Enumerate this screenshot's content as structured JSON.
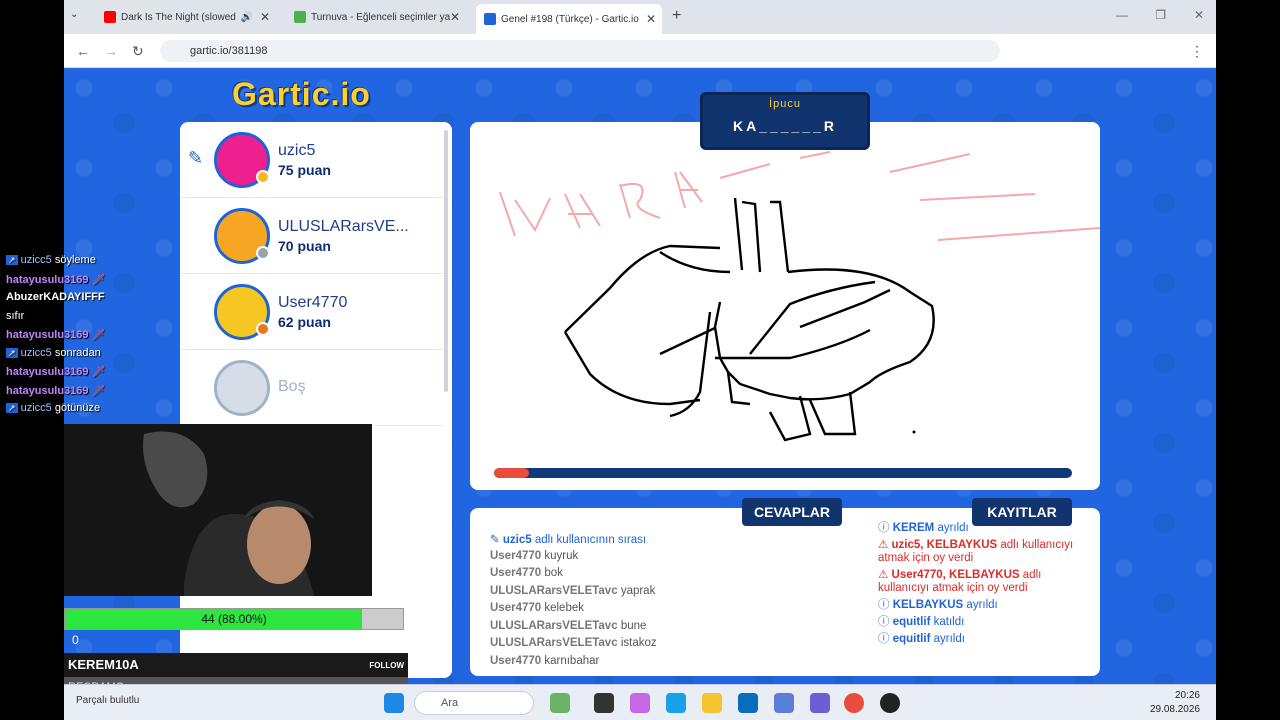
{
  "browser": {
    "tabs": [
      {
        "title": "Dark Is The Night (slowed",
        "icon": "youtube-icon"
      },
      {
        "title": "Turnuva - Eğlenceli seçimler ya",
        "icon": "tournament-icon"
      },
      {
        "title": "Genel #198 (Türkçe) - Gartic.io",
        "icon": "gartic-icon"
      }
    ],
    "url": "gartic.io/381198"
  },
  "game": {
    "logo": "Gartic.io",
    "hint": {
      "title": "İpucu",
      "word": "KA______R"
    },
    "timer_progress": 0.06,
    "players": [
      {
        "name": "uzic5",
        "score": "75 puan",
        "drawing": true,
        "avatar_color": "#ee1f8f"
      },
      {
        "name": "ULUSLARarsVE...",
        "score": "70 puan",
        "drawing": false,
        "avatar_color": "#f6a623"
      },
      {
        "name": "User4770",
        "score": "62 puan",
        "drawing": false,
        "avatar_color": "#f6c623"
      },
      {
        "name": "Boş",
        "score": "",
        "drawing": false,
        "avatar_color": "#d6dde6"
      }
    ],
    "answers_label": "CEVAPLAR",
    "logs_label": "KAYITLAR",
    "answers": [
      {
        "user": "uzic5",
        "text": "adlı kullanıcının sırası",
        "system": true
      },
      {
        "user": "User4770",
        "text": "kuyruk"
      },
      {
        "user": "User4770",
        "text": "bok"
      },
      {
        "user": "ULUSLARarsVELETavc",
        "text": "yaprak"
      },
      {
        "user": "User4770",
        "text": "kelebek"
      },
      {
        "user": "ULUSLARarsVELETavc",
        "text": "bune"
      },
      {
        "user": "ULUSLARarsVELETavc",
        "text": "istakoz"
      },
      {
        "user": "User4770",
        "text": "karnıbahar"
      }
    ],
    "logs": [
      {
        "user": "KEREM",
        "text": "ayrıldı",
        "type": "info"
      },
      {
        "user": "uzic5, KELBAYKUS",
        "text": "adlı kullanıcıyı atmak için oy verdi",
        "type": "warn"
      },
      {
        "user": "User4770, KELBAYKUS",
        "text": "adlı kullanıcıyı atmak için oy verdi",
        "type": "warn"
      },
      {
        "user": "KELBAYKUS",
        "text": "ayrıldı",
        "type": "info"
      },
      {
        "user": "equitlif",
        "text": "katıldı",
        "type": "info"
      },
      {
        "user": "equitlif",
        "text": "ayrıldı",
        "type": "info"
      }
    ]
  },
  "stream": {
    "chat": [
      {
        "user": "uzicc5",
        "text": "söyleme",
        "kind": "sys"
      },
      {
        "user": "hatayusulu3169",
        "text": "",
        "kind": "user"
      },
      {
        "user": "AbuzerKADAYIFFF",
        "text": "",
        "kind": "bold"
      },
      {
        "user": "",
        "text": "sıfır",
        "kind": "plain"
      },
      {
        "user": "hatayusulu3169",
        "text": "",
        "kind": "user"
      },
      {
        "user": "uzicc5",
        "text": "sonradan",
        "kind": "sys"
      },
      {
        "user": "hatayusulu3169",
        "text": "",
        "kind": "user"
      },
      {
        "user": "hatayusulu3169",
        "text": "",
        "kind": "user"
      },
      {
        "user": "uzicc5",
        "text": "götünüze",
        "kind": "sys"
      }
    ],
    "follow_goal_text": "44 (88.00%)",
    "follow_goal_progress": 0.88,
    "follow_goal_start": "0",
    "alerts": [
      {
        "name": "KEREM10A",
        "label": "FOLLOW"
      },
      {
        "name": "RECRAMO",
        "label": "FOLLOW"
      }
    ]
  },
  "taskbar": {
    "weather": "Parçalı bulutlu",
    "search_placeholder": "Ara",
    "time": "20:26",
    "date": "29.08.2026"
  }
}
